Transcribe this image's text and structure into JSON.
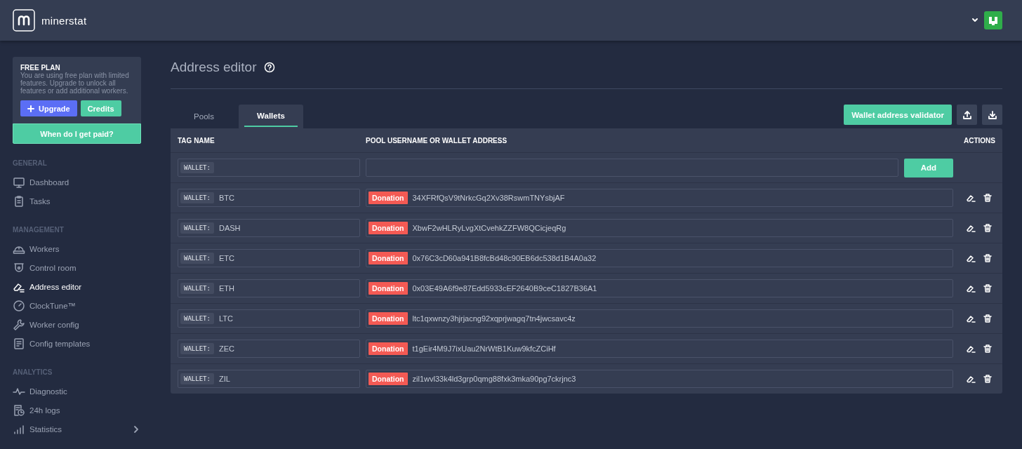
{
  "header": {
    "brand": "minerstat"
  },
  "plan": {
    "title": "FREE PLAN",
    "text": "You are using free plan with limited features. Upgrade to unlock all features or add additional workers.",
    "buttons": [
      {
        "label": "Upgrade",
        "kind": "upgrade"
      },
      {
        "label": "Credits",
        "kind": "credits"
      }
    ],
    "payout": "When do I get paid?"
  },
  "sidebar": {
    "sections": [
      {
        "title": "GENERAL",
        "items": [
          {
            "label": "Dashboard",
            "selected": false,
            "expandable": false
          },
          {
            "label": "Tasks",
            "selected": false,
            "expandable": false
          }
        ]
      },
      {
        "title": "MANAGEMENT",
        "items": [
          {
            "label": "Workers",
            "selected": false,
            "expandable": false
          },
          {
            "label": "Control room",
            "selected": false,
            "expandable": false
          },
          {
            "label": "Address editor",
            "selected": true,
            "expandable": false
          },
          {
            "label": "ClockTune™",
            "selected": false,
            "expandable": false
          },
          {
            "label": "Worker config",
            "selected": false,
            "expandable": false
          },
          {
            "label": "Config templates",
            "selected": false,
            "expandable": false
          }
        ]
      },
      {
        "title": "ANALYTICS",
        "items": [
          {
            "label": "Diagnostic",
            "selected": false,
            "expandable": false
          },
          {
            "label": "24h logs",
            "selected": false,
            "expandable": false
          },
          {
            "label": "Statistics",
            "selected": false,
            "expandable": true
          }
        ]
      }
    ]
  },
  "page": {
    "title": "Address editor"
  },
  "tabs": [
    {
      "label": "Pools",
      "selected": false
    },
    {
      "label": "Wallets",
      "selected": true
    }
  ],
  "toolbar": {
    "validator": "Wallet address validator"
  },
  "table": {
    "columns": [
      "TAG NAME",
      "POOL USERNAME OR WALLET ADDRESS",
      "ACTIONS"
    ],
    "rows": [
      {
        "kind": "new",
        "prefix": "WALLET:",
        "button": "Add"
      },
      {
        "kind": "entry",
        "prefix": "WALLET:",
        "tag": "BTC",
        "badge": "Donation",
        "address": "34XFRfQsV9tNrkcGq2Xv38RswmTNYsbjAF"
      },
      {
        "kind": "entry",
        "prefix": "WALLET:",
        "tag": "DASH",
        "badge": "Donation",
        "address": "XbwF2wHLRyLvgXtCvehkZZFW8QCicjeqRg"
      },
      {
        "kind": "entry",
        "prefix": "WALLET:",
        "tag": "ETC",
        "badge": "Donation",
        "address": "0x76C3cD60a941B8fcBd48c90EB6dc538d1B4A0a32"
      },
      {
        "kind": "entry",
        "prefix": "WALLET:",
        "tag": "ETH",
        "badge": "Donation",
        "address": "0x03E49A6f9e87Edd5933cEF2640B9ceC1827B36A1"
      },
      {
        "kind": "entry",
        "prefix": "WALLET:",
        "tag": "LTC",
        "badge": "Donation",
        "address": "ltc1qxwnzy3hjrjacng92xqprjwagq7tn4jwcsavc4z"
      },
      {
        "kind": "entry",
        "prefix": "WALLET:",
        "tag": "ZEC",
        "badge": "Donation",
        "address": "t1gEir4M9J7ixUau2NrWtB1Kuw9kfcZCiHf"
      },
      {
        "kind": "entry",
        "prefix": "WALLET:",
        "tag": "ZIL",
        "badge": "Donation",
        "address": "zil1wvl33k4ld3grp0qmg88fxk3mka90pg7ckrjnc3"
      }
    ]
  }
}
